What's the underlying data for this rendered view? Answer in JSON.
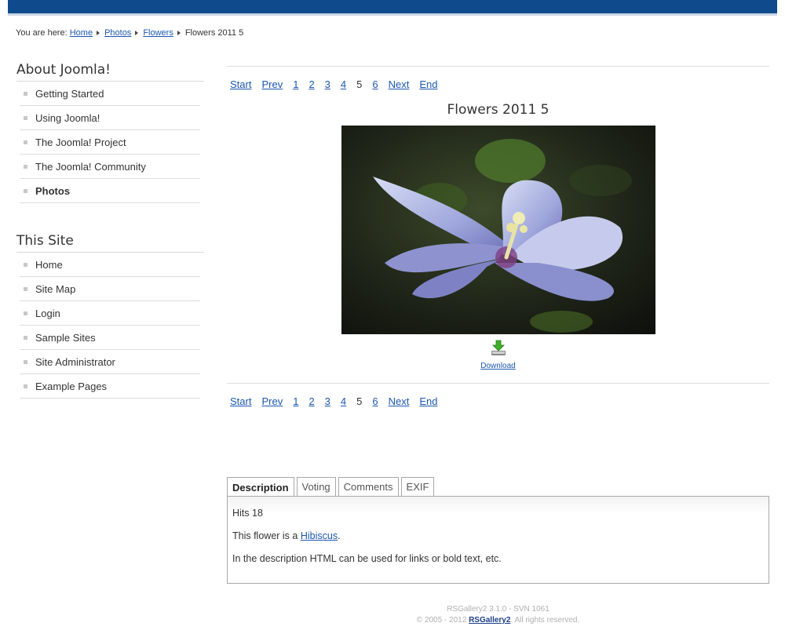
{
  "breadcrumb": {
    "prefix": "You are here:",
    "links": [
      "Home",
      "Photos",
      "Flowers"
    ],
    "current": "Flowers 2011 5"
  },
  "about_module": {
    "title": "About Joomla!",
    "items": [
      "Getting Started",
      "Using Joomla!",
      "The Joomla! Project",
      "The Joomla! Community",
      "Photos"
    ]
  },
  "site_module": {
    "title": "This Site",
    "items": [
      "Home",
      "Site Map",
      "Login",
      "Sample Sites",
      "Site Administrator",
      "Example Pages"
    ]
  },
  "pager": {
    "start": "Start",
    "prev": "Prev",
    "pages": [
      "1",
      "2",
      "3",
      "4",
      "5",
      "6"
    ],
    "current_page": "5",
    "next": "Next",
    "end": "End"
  },
  "image": {
    "title": "Flowers 2011 5",
    "download_label": "Download"
  },
  "tabs": [
    "Description",
    "Voting",
    "Comments",
    "EXIF"
  ],
  "description": {
    "hits": "Hits 18",
    "line1_prefix": "This flower is a ",
    "line1_link": "Hibiscus",
    "line1_suffix": ".",
    "line2": "In the description HTML can be used for links or bold text, etc."
  },
  "footer": {
    "version": "RSGallery2 3.1.0 - SVN 1061",
    "copyright_prefix": "© 2005 - 2012 ",
    "copyright_link": "RSGallery2",
    "copyright_suffix": ". All rights reserved."
  },
  "colors": {
    "header_bar": "#0f4a8c",
    "link": "#1b57b1"
  }
}
